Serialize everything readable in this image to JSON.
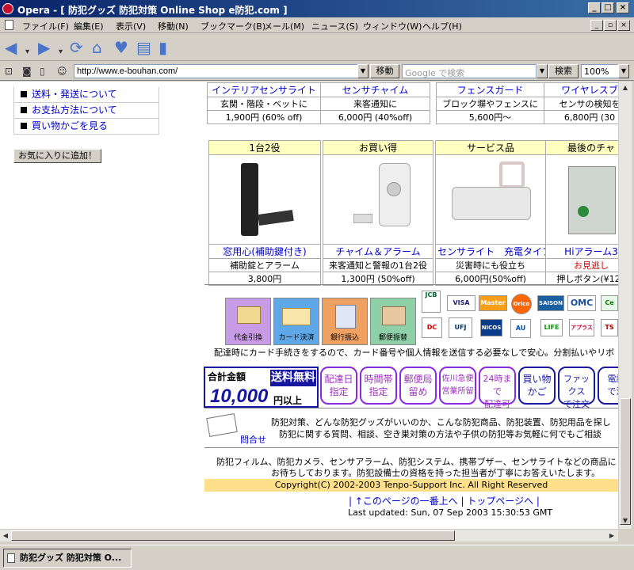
{
  "window": {
    "title": "Opera - [ 防犯グッズ 防犯対策 Online Shop e防犯.com ]",
    "min_label": "_",
    "max_label": "□",
    "close_label": "×"
  },
  "menu": {
    "items": [
      "ファイル(F)",
      "編集(E)",
      "表示(V)",
      "移動(N)",
      "ブックマーク(B)",
      "メール(M)",
      "ニュース(S)",
      "ウィンドウ(W)",
      "ヘルプ(H)"
    ],
    "mdi_min": "_",
    "mdi_restore": "▫",
    "mdi_close": "×"
  },
  "address": {
    "url": "http://www.e-bouhan.com/",
    "go_label": "移動",
    "search_placeholder": "Google で検索",
    "search_label": "検索",
    "zoom": "100%"
  },
  "nav": {
    "items": [
      "送料・発送について",
      "お支払方法について",
      "買い物かごを見る"
    ],
    "favorite_label": "お気に入りに追加！"
  },
  "top_products": [
    {
      "name": "インテリアセンサライト",
      "desc": "玄関・階段・ベットに",
      "price": "1,900円 (60% off)"
    },
    {
      "name": "センサチャイム",
      "desc": "来客通知に",
      "price": "6,000円 (40%off)"
    },
    {
      "name": "フェンスガード",
      "desc": "ブロック塀やフェンスに",
      "price": "5,600円〜"
    },
    {
      "name": "ワイヤレスブ",
      "desc": "センサの検知を",
      "price": "6,800円 (30"
    }
  ],
  "products": [
    {
      "header": "1台2役",
      "name": "窓用心(補助鍵付き)",
      "desc": "補助錠とアラーム",
      "price": "3,800円"
    },
    {
      "header": "お買い得",
      "name": "チャイム＆アラーム",
      "desc": "来客通知と警報の1台2役",
      "price": "1,300円 (50%off)"
    },
    {
      "header": "サービス品",
      "name": "センサライト　充電タイプ",
      "desc": "災害時にも役立ち",
      "price": "6,000円(50%off)"
    },
    {
      "header": "最後のチャ",
      "name": "Hiアラーム3",
      "desc": "お見逃し",
      "price": "押しボタン(¥120"
    }
  ],
  "payment": {
    "methods": [
      "代金引換",
      "カード決済",
      "銀行振込",
      "郵便振替"
    ],
    "cards_row1": [
      "JCB",
      "VISA",
      "Master",
      "Orico",
      "SAISON",
      "OMC",
      "Ce"
    ],
    "cards_row2": [
      "DC",
      "UFJ",
      "NICOS",
      "AU",
      "LIFE",
      "アプラス",
      "TS"
    ],
    "notice": "配達時にカード手続きをするので、カード番号や個人情報を送信する必要なしで安心。分割払いやリボ"
  },
  "shipping": {
    "total_label": "合計金額",
    "free_label": "送料無料",
    "amount": "10,000",
    "above": "円以上"
  },
  "benefits": [
    "配達日\n指定",
    "時間帯\n指定",
    "郵便局\n留め",
    "佐川急便\n営業所留",
    "24時まで\n配達可",
    "買い物\nかご",
    "ファックス\nで注文",
    "電話\nで注"
  ],
  "contact": {
    "label": "問合せ",
    "line1": "防犯対策、どんな防犯グッズがいいのか、こんな防犯商品、防犯装置、防犯用品を探し",
    "line2": "防犯に関する質問、相談、空き巣対策の方法や子供の防犯等お気軽に何でもご相談"
  },
  "footer": {
    "line1": "防犯フィルム、防犯カメラ、センサアラーム、防犯システム、携帯ブザー、センサライトなどの商品に",
    "line2": "お待ちしております。防犯設備士の資格を持った担当者が丁寧にお答えいたします。",
    "copyright": "Copyright(C) 2002-2003  Tenpo-Support Inc.  All Right Reserved",
    "nav_links": "| ↑このページの一番上へ | トップページへ |",
    "updated": "Last updated: Sun, 07 Sep 2003 15:30:53 GMT"
  },
  "taskbar": {
    "task_label": "防犯グッズ 防犯対策 O..."
  }
}
